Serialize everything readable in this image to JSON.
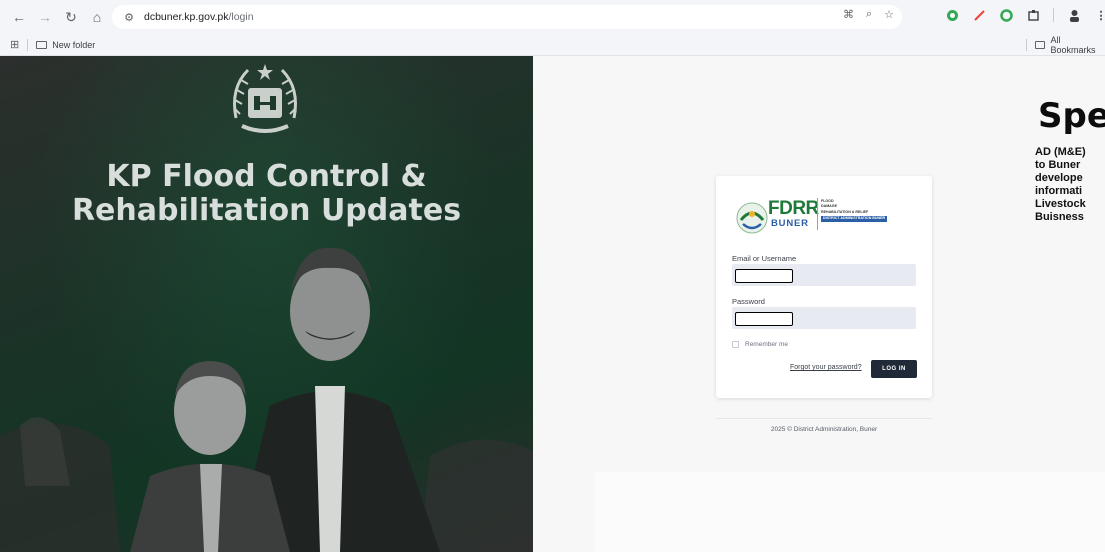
{
  "browser": {
    "url_host": "dcbuner.kp.gov.pk",
    "url_path": "/login",
    "bookmarks": {
      "new_folder": "New folder",
      "all_bookmarks": "All Bookmarks"
    }
  },
  "hero": {
    "title_line1": "KP Flood Control &",
    "title_line2": "Rehabilitation Updates"
  },
  "login": {
    "logo_main": "FDRR",
    "logo_sub": "BUNER",
    "logo_tag1": "FLOOD",
    "logo_tag2": "DAMAGE",
    "logo_tag3": "REHABILITATION & RELIEF",
    "logo_tag4": "DISTRICT ADMINISTRATION BUNER",
    "email_label": "Email or Username",
    "password_label": "Password",
    "remember_label": "Remember me",
    "forgot_link": "Forgot your password?",
    "login_button": "LOG IN",
    "footer": "2025 © District Administration, Buner"
  },
  "side_panel": {
    "title": "Spe",
    "lines": [
      "AD (M&E)",
      "to Buner",
      "develope",
      "informati",
      "Livestock",
      "Buisness"
    ]
  },
  "colors": {
    "button_bg": "#1f2937",
    "field_bg": "#e8eaf2",
    "logo_green": "#1f7a3a"
  }
}
